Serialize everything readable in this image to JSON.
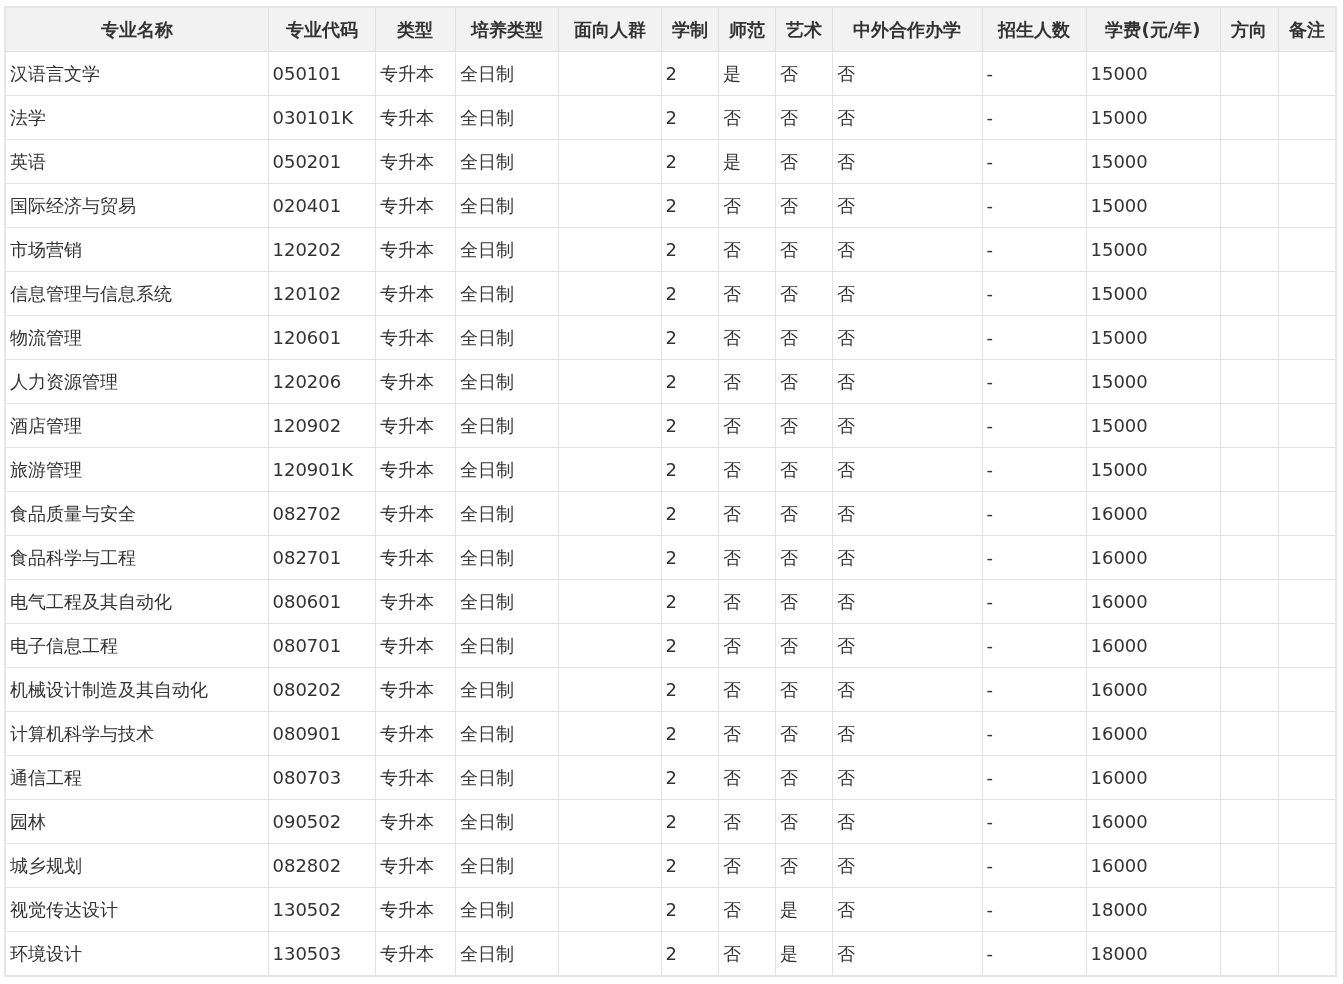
{
  "table": {
    "columns": [
      "专业名称",
      "专业代码",
      "类型",
      "培养类型",
      "面向人群",
      "学制",
      "师范",
      "艺术",
      "中外合作办学",
      "招生人数",
      "学费(元/年)",
      "方向",
      "备注"
    ],
    "rows": [
      [
        "汉语言文学",
        "050101",
        "专升本",
        "全日制",
        null,
        "2",
        "是",
        "否",
        "否",
        "-",
        "15000",
        null,
        null
      ],
      [
        "法学",
        "030101K",
        "专升本",
        "全日制",
        null,
        "2",
        "否",
        "否",
        "否",
        "-",
        "15000",
        null,
        null
      ],
      [
        "英语",
        "050201",
        "专升本",
        "全日制",
        null,
        "2",
        "是",
        "否",
        "否",
        "-",
        "15000",
        null,
        null
      ],
      [
        "国际经济与贸易",
        "020401",
        "专升本",
        "全日制",
        null,
        "2",
        "否",
        "否",
        "否",
        "-",
        "15000",
        null,
        null
      ],
      [
        "市场营销",
        "120202",
        "专升本",
        "全日制",
        null,
        "2",
        "否",
        "否",
        "否",
        "-",
        "15000",
        null,
        null
      ],
      [
        "信息管理与信息系统",
        "120102",
        "专升本",
        "全日制",
        null,
        "2",
        "否",
        "否",
        "否",
        "-",
        "15000",
        null,
        null
      ],
      [
        "物流管理",
        "120601",
        "专升本",
        "全日制",
        null,
        "2",
        "否",
        "否",
        "否",
        "-",
        "15000",
        null,
        null
      ],
      [
        "人力资源管理",
        "120206",
        "专升本",
        "全日制",
        null,
        "2",
        "否",
        "否",
        "否",
        "-",
        "15000",
        null,
        null
      ],
      [
        "酒店管理",
        "120902",
        "专升本",
        "全日制",
        null,
        "2",
        "否",
        "否",
        "否",
        "-",
        "15000",
        null,
        null
      ],
      [
        "旅游管理",
        "120901K",
        "专升本",
        "全日制",
        null,
        "2",
        "否",
        "否",
        "否",
        "-",
        "15000",
        null,
        null
      ],
      [
        "食品质量与安全",
        "082702",
        "专升本",
        "全日制",
        null,
        "2",
        "否",
        "否",
        "否",
        "-",
        "16000",
        null,
        null
      ],
      [
        "食品科学与工程",
        "082701",
        "专升本",
        "全日制",
        null,
        "2",
        "否",
        "否",
        "否",
        "-",
        "16000",
        null,
        null
      ],
      [
        "电气工程及其自动化",
        "080601",
        "专升本",
        "全日制",
        null,
        "2",
        "否",
        "否",
        "否",
        "-",
        "16000",
        null,
        null
      ],
      [
        "电子信息工程",
        "080701",
        "专升本",
        "全日制",
        null,
        "2",
        "否",
        "否",
        "否",
        "-",
        "16000",
        null,
        null
      ],
      [
        "机械设计制造及其自动化",
        "080202",
        "专升本",
        "全日制",
        null,
        "2",
        "否",
        "否",
        "否",
        "-",
        "16000",
        null,
        null
      ],
      [
        "计算机科学与技术",
        "080901",
        "专升本",
        "全日制",
        null,
        "2",
        "否",
        "否",
        "否",
        "-",
        "16000",
        null,
        null
      ],
      [
        "通信工程",
        "080703",
        "专升本",
        "全日制",
        null,
        "2",
        "否",
        "否",
        "否",
        "-",
        "16000",
        null,
        null
      ],
      [
        "园林",
        "090502",
        "专升本",
        "全日制",
        null,
        "2",
        "否",
        "否",
        "否",
        "-",
        "16000",
        null,
        null
      ],
      [
        "城乡规划",
        "082802",
        "专升本",
        "全日制",
        null,
        "2",
        "否",
        "否",
        "否",
        "-",
        "16000",
        null,
        null
      ],
      [
        "视觉传达设计",
        "130502",
        "专升本",
        "全日制",
        null,
        "2",
        "否",
        "是",
        "否",
        "-",
        "18000",
        null,
        null
      ],
      [
        "环境设计",
        "130503",
        "专升本",
        "全日制",
        null,
        "2",
        "否",
        "是",
        "否",
        "-",
        "18000",
        null,
        null
      ]
    ]
  }
}
